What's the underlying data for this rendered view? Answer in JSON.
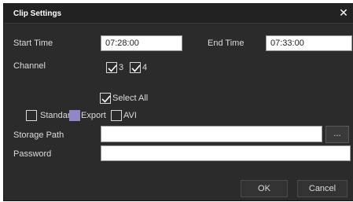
{
  "dialog": {
    "title": "Clip Settings",
    "close_glyph": "✕"
  },
  "time": {
    "start_label": "Start Time",
    "start_value": "07:28:00",
    "end_label": "End Time",
    "end_value": "07:33:00"
  },
  "channel": {
    "label": "Channel",
    "items": [
      {
        "label": "3",
        "checked": true
      },
      {
        "label": "4",
        "checked": true
      }
    ]
  },
  "select_all": {
    "label": "Select All",
    "checked": true
  },
  "formats": [
    {
      "label": "Standard",
      "state": "unchecked"
    },
    {
      "label": "Export",
      "state": "selected"
    },
    {
      "label": "AVI",
      "state": "unchecked"
    }
  ],
  "storage": {
    "label": "Storage Path",
    "value": "",
    "browse_label": "..."
  },
  "password": {
    "label": "Password",
    "value": ""
  },
  "footer": {
    "ok_label": "OK",
    "cancel_label": "Cancel"
  },
  "colors": {
    "background": "#2b2b2b",
    "titlebar": "#222222",
    "selected_box": "#8f87c7"
  }
}
